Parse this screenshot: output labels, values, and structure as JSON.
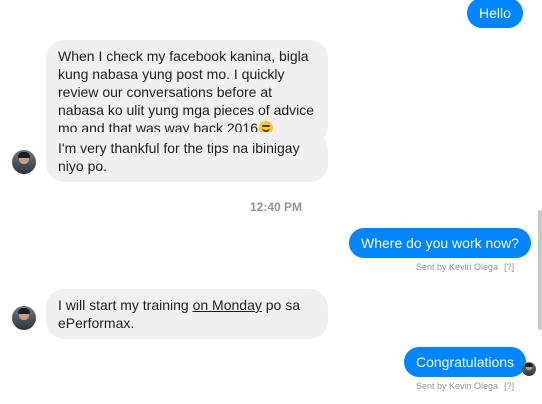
{
  "conversation": {
    "messages": [
      {
        "id": "m1",
        "text": "Hello"
      },
      {
        "id": "m2",
        "text": "When I check my facebook kanina, bigla kung nabasa yung post mo. I quickly review our conversations before at nabasa ko ulit yung mga pieces of advice mo and that was way back 2016"
      },
      {
        "id": "m3",
        "text": "I'm very thankful for the tips na ibinigay niyo po."
      },
      {
        "id": "m4",
        "text": "Where do you work now?"
      },
      {
        "id": "m5",
        "text_before": "I will start my training ",
        "link_text": "on Monday",
        "text_after": " po sa ePerformax."
      },
      {
        "id": "m6",
        "text": "Congratulations"
      }
    ],
    "timestamp": "12:40 PM",
    "receipts": [
      {
        "text": "Sent by Kevin Olega",
        "help": "[?]"
      },
      {
        "text": "Sent by Kevin Olega",
        "help": "[?]"
      }
    ]
  },
  "icons": {
    "avatar": "contact-avatar",
    "emoji": "grinning-face-icon",
    "seen_avatar": "seen-avatar-icon"
  },
  "colors": {
    "outgoing_bubble": "#0084ff",
    "incoming_bubble": "#f1f0f0",
    "meta_text": "#90949c"
  }
}
